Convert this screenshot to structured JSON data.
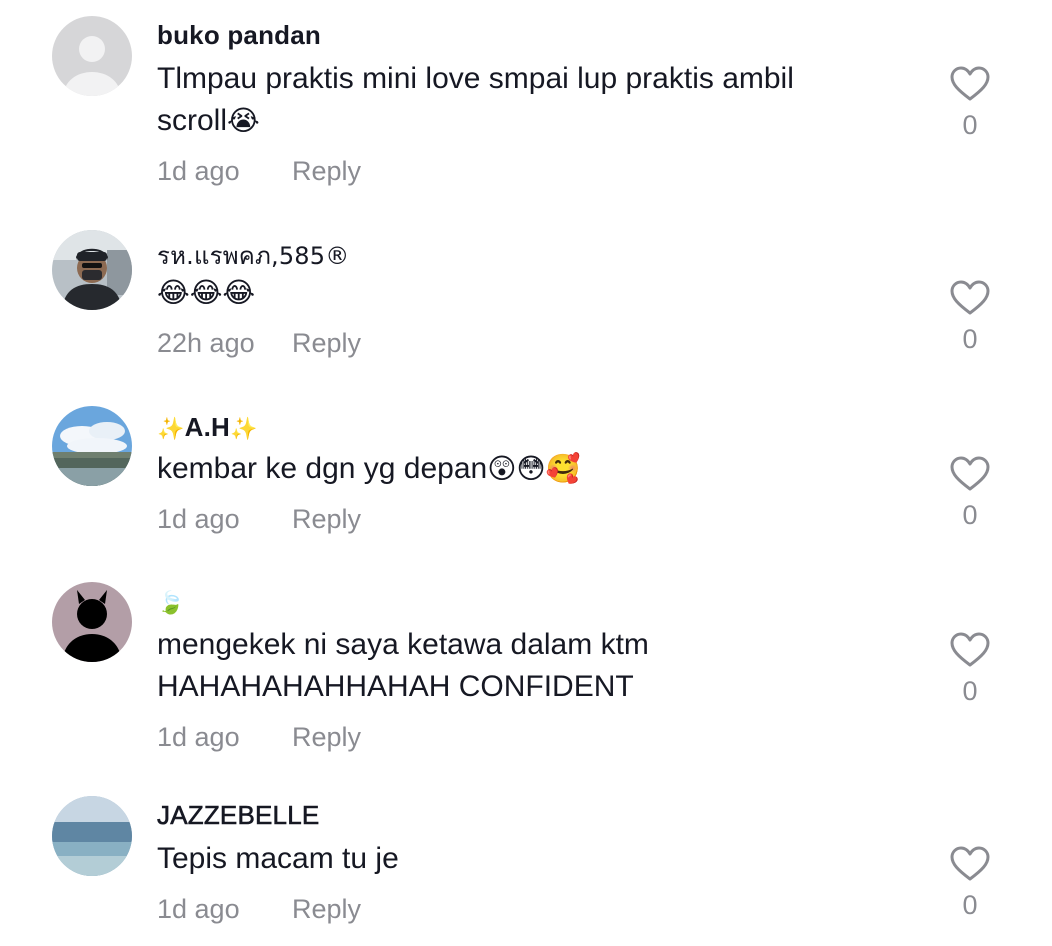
{
  "comments": [
    {
      "username": "buko pandan",
      "text_line1": "Tlmpau praktis mini love smpai lup praktis ambil",
      "text_line2": "scroll",
      "text_emoji": "😭",
      "time": "1d ago",
      "reply_label": "Reply",
      "likes": "0",
      "avatar_icon": "default-avatar-icon"
    },
    {
      "username": "รห.แรพคภ,585®",
      "text_emoji": "😂😂😂",
      "time": "22h ago",
      "reply_label": "Reply",
      "likes": "0",
      "avatar_icon": "user-photo-avatar"
    },
    {
      "username_prefix": "✨",
      "username": "A.H",
      "username_suffix": "✨",
      "text_line1": "kembar ke dgn yg depan",
      "text_emoji": "😲😳🥰",
      "time": "1d ago",
      "reply_label": "Reply",
      "likes": "0",
      "avatar_icon": "sky-photo-avatar"
    },
    {
      "username_emoji": "🍃",
      "text_line1": "mengekek ni saya ketawa dalam ktm",
      "text_line2": "HAHAHAHAHHAHAH CONFIDENT",
      "time": "1d ago",
      "reply_label": "Reply",
      "likes": "0",
      "avatar_icon": "devil-silhouette-avatar"
    },
    {
      "username": "JAZZEBELLE",
      "text_line1": "Tepis macam tu je",
      "time": "1d ago",
      "reply_label": "Reply",
      "likes": "0",
      "avatar_icon": "sea-photo-avatar"
    }
  ],
  "colors": {
    "text_primary": "#161823",
    "text_secondary": "#8a8b91",
    "heart_outline": "#8a8b91"
  }
}
